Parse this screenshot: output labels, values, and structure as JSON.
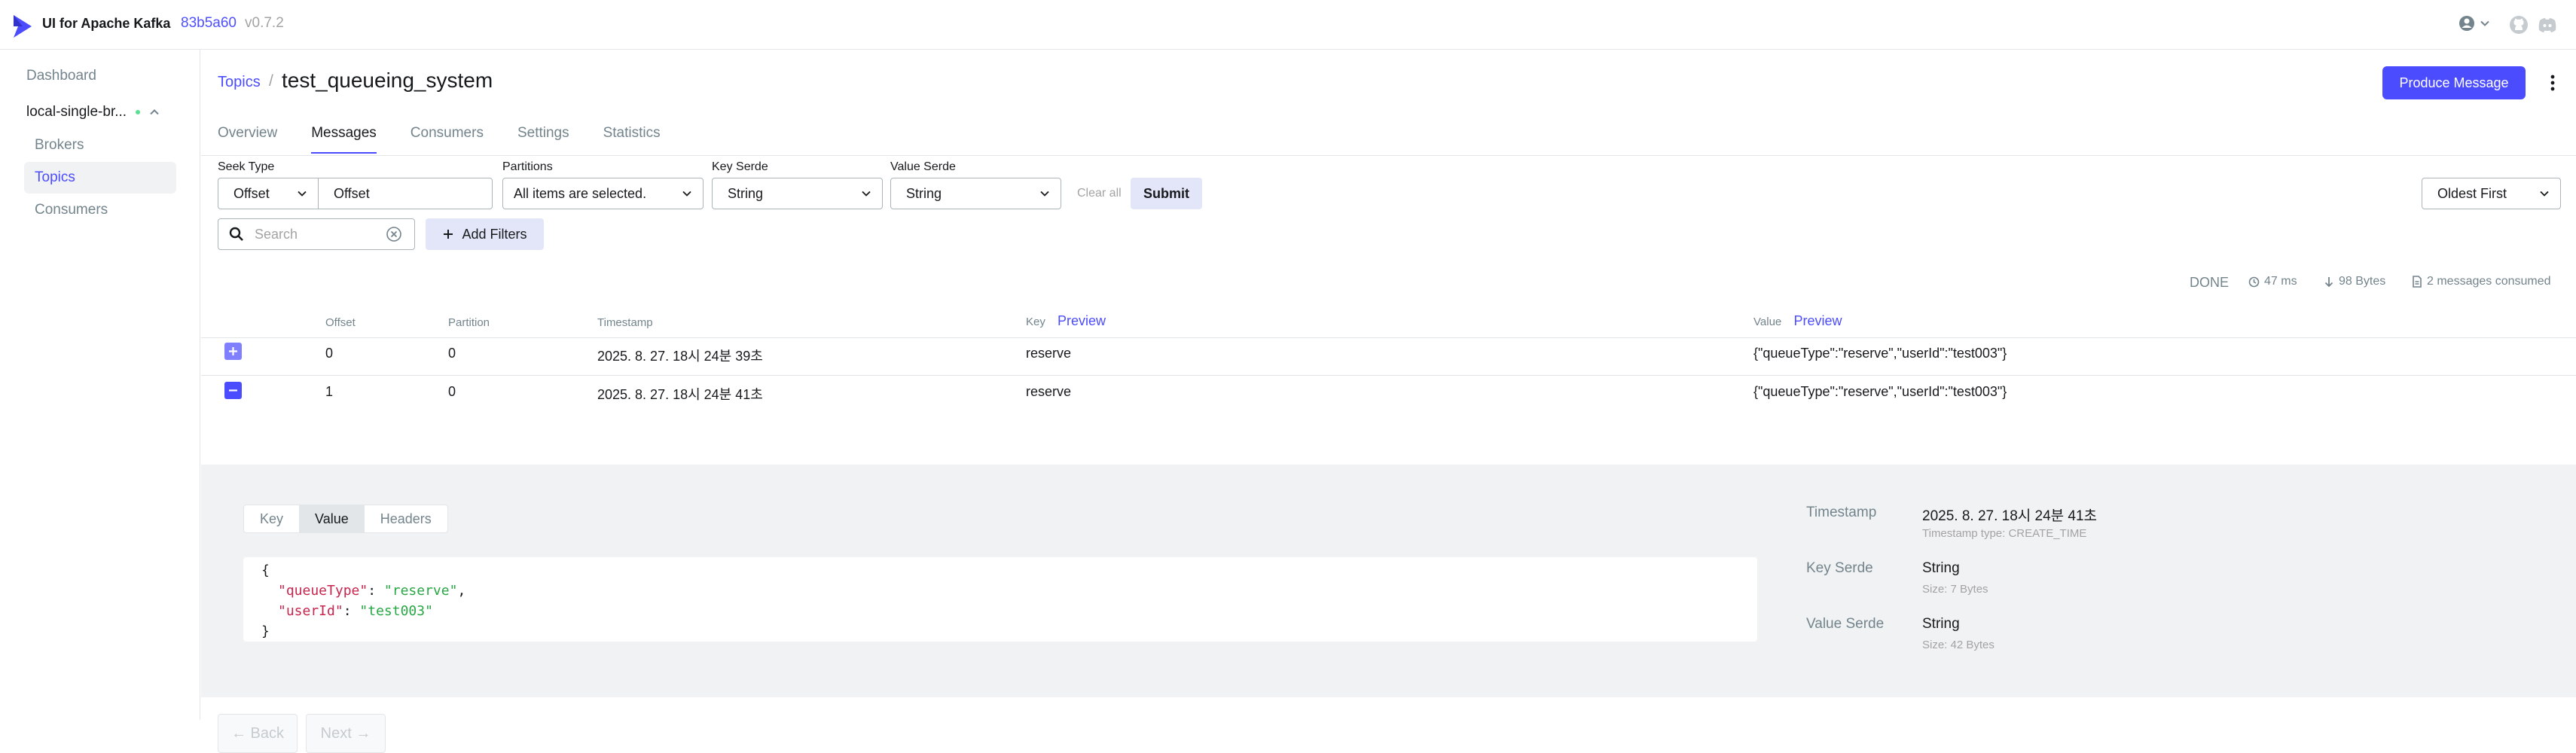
{
  "app": {
    "brand": "UI for Apache Kafka",
    "version_hash": "83b5a60",
    "version": "v0.7.2"
  },
  "colors": {
    "accent": "#4C4CFF",
    "status_online": "#5BE093",
    "muted_text": "#73848C"
  },
  "sidebar": {
    "dashboard": "Dashboard",
    "cluster": "local-single-br...",
    "items": [
      {
        "label": "Brokers",
        "active": false
      },
      {
        "label": "Topics",
        "active": true
      },
      {
        "label": "Consumers",
        "active": false
      }
    ]
  },
  "header": {
    "breadcrumb": "Topics",
    "separator": "/",
    "title": "test_queueing_system",
    "produce_button": "Produce Message"
  },
  "tabs": [
    {
      "label": "Overview",
      "active": false
    },
    {
      "label": "Messages",
      "active": true
    },
    {
      "label": "Consumers",
      "active": false
    },
    {
      "label": "Settings",
      "active": false
    },
    {
      "label": "Statistics",
      "active": false
    }
  ],
  "filters": {
    "seek_type_label": "Seek Type",
    "seek_type_value": "Offset",
    "offset_placeholder": "Offset",
    "partitions_label": "Partitions",
    "partitions_value": "All items are selected.",
    "key_serde_label": "Key Serde",
    "key_serde_value": "String",
    "value_serde_label": "Value Serde",
    "value_serde_value": "String",
    "clear_all": "Clear all",
    "submit": "Submit",
    "sort_value": "Oldest First",
    "search_placeholder": "Search",
    "add_filters": "Add Filters"
  },
  "meta": {
    "status": "DONE",
    "elapsed": "47 ms",
    "bytes": "98 Bytes",
    "consumed": "2 messages consumed"
  },
  "table": {
    "headers": {
      "offset": "Offset",
      "partition": "Partition",
      "timestamp": "Timestamp",
      "key": "Key",
      "value": "Value",
      "preview": "Preview"
    },
    "rows": [
      {
        "offset": "0",
        "partition": "0",
        "timestamp": "2025. 8. 27. 18시 24분 39초",
        "key": "reserve",
        "value": "{\"queueType\":\"reserve\",\"userId\":\"test003\"}",
        "expanded": false
      },
      {
        "offset": "1",
        "partition": "0",
        "timestamp": "2025. 8. 27. 18시 24분 41초",
        "key": "reserve",
        "value": "{\"queueType\":\"reserve\",\"userId\":\"test003\"}",
        "expanded": true
      }
    ]
  },
  "detail": {
    "tabs": [
      {
        "label": "Key",
        "active": false
      },
      {
        "label": "Value",
        "active": true
      },
      {
        "label": "Headers",
        "active": false
      }
    ],
    "json": {
      "open": "{",
      "k1": "\"queueType\"",
      "v1": "\"reserve\"",
      "k2": "\"userId\"",
      "v2": "\"test003\"",
      "close": "}"
    },
    "timestamp_label": "Timestamp",
    "timestamp_value": "2025. 8. 27. 18시 24분 41초",
    "timestamp_type": "Timestamp type: CREATE_TIME",
    "key_serde_label": "Key Serde",
    "key_serde_value": "String",
    "key_size": "Size: 7 Bytes",
    "value_serde_label": "Value Serde",
    "value_serde_value": "String",
    "value_size": "Size: 42 Bytes"
  },
  "pagination": {
    "back": "← Back",
    "next": "Next →"
  }
}
